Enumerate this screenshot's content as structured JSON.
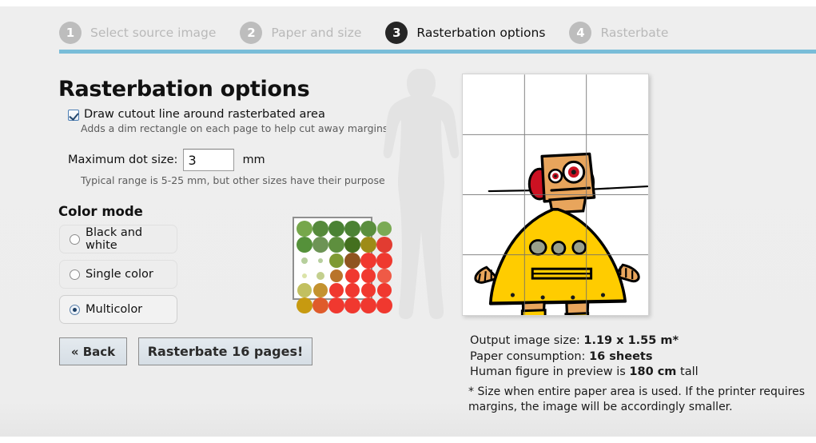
{
  "steps": [
    {
      "num": "1",
      "label": "Select source image",
      "active": false
    },
    {
      "num": "2",
      "label": "Paper and size",
      "active": false
    },
    {
      "num": "3",
      "label": "Rasterbation options",
      "active": true
    },
    {
      "num": "4",
      "label": "Rasterbate",
      "active": false
    }
  ],
  "page_title": "Rasterbation options",
  "cutout": {
    "label": "Draw cutout line around rasterbated area",
    "hint": "Adds a dim rectangle on each page to help cut away margins",
    "checked": true
  },
  "dot_size": {
    "label": "Maximum dot size:",
    "value": "3",
    "unit": "mm",
    "hint": "Typical range is 5-25 mm, but other sizes have their purpose"
  },
  "color_mode": {
    "heading": "Color mode",
    "options": [
      {
        "label": "Black and white",
        "selected": false
      },
      {
        "label": "Single color",
        "selected": false
      },
      {
        "label": "Multicolor",
        "selected": true
      }
    ]
  },
  "buttons": {
    "back": "« Back",
    "rasterbate": "Rasterbate 16 pages!"
  },
  "info": {
    "output_size_label": "Output image size:",
    "output_size_value": "1.19 x 1.55 m*",
    "paper_label": "Paper consumption:",
    "paper_value": "16 sheets",
    "human_prefix": "Human figure in preview is",
    "human_value": "180 cm",
    "human_suffix": "tall",
    "footnote": "* Size when entire paper area is used. If the printer requires margins, the image will be accordingly smaller."
  },
  "colors": {
    "accent_rule": "#79bdd8",
    "active_bubble": "#262626",
    "inactive_bubble": "#bdbdbd",
    "page_bg": "#ededed",
    "robot_yellow": "#ffcc00",
    "robot_tan": "#e8a55c",
    "robot_red": "#cc1122"
  },
  "swatch_dots": [
    [
      {
        "c": "#76a74b",
        "r": 10
      },
      {
        "c": "#568a3c",
        "r": 10
      },
      {
        "c": "#4a8234",
        "r": 10
      },
      {
        "c": "#4c8234",
        "r": 10
      },
      {
        "c": "#5b8f3e",
        "r": 10
      },
      {
        "c": "#7aaa55",
        "r": 9
      }
    ],
    [
      {
        "c": "#55913a",
        "r": 10
      },
      {
        "c": "#6d9455",
        "r": 10
      },
      {
        "c": "#5e8f3e",
        "r": 10
      },
      {
        "c": "#44701f",
        "r": 10
      },
      {
        "c": "#9d8b17",
        "r": 10
      },
      {
        "c": "#e23c31",
        "r": 10
      }
    ],
    [
      {
        "c": "#b6cf9c",
        "r": 4
      },
      {
        "c": "#b7cf9e",
        "r": 3
      },
      {
        "c": "#7f9a33",
        "r": 9
      },
      {
        "c": "#8f5520",
        "r": 10
      },
      {
        "c": "#f0382f",
        "r": 10
      },
      {
        "c": "#ef392f",
        "r": 10
      }
    ],
    [
      {
        "c": "#dbe3a8",
        "r": 3
      },
      {
        "c": "#c3cf8e",
        "r": 5
      },
      {
        "c": "#b9742a",
        "r": 8
      },
      {
        "c": "#f0382f",
        "r": 9
      },
      {
        "c": "#f0392f",
        "r": 9
      },
      {
        "c": "#ef5a46",
        "r": 9
      }
    ],
    [
      {
        "c": "#c2c060",
        "r": 9
      },
      {
        "c": "#c4922f",
        "r": 9
      },
      {
        "c": "#f0382f",
        "r": 9
      },
      {
        "c": "#f0382f",
        "r": 9
      },
      {
        "c": "#f0382f",
        "r": 9
      },
      {
        "c": "#f0382f",
        "r": 9
      }
    ],
    [
      {
        "c": "#c79a10",
        "r": 10
      },
      {
        "c": "#df5b2b",
        "r": 10
      },
      {
        "c": "#f0382f",
        "r": 10
      },
      {
        "c": "#f0382f",
        "r": 10
      },
      {
        "c": "#f0382f",
        "r": 10
      },
      {
        "c": "#f0382f",
        "r": 10
      }
    ]
  ],
  "preview": {
    "grid_cols": 3,
    "grid_rows": 4,
    "alt": "rasterbated preview of yellow robot illustration with page grid"
  }
}
